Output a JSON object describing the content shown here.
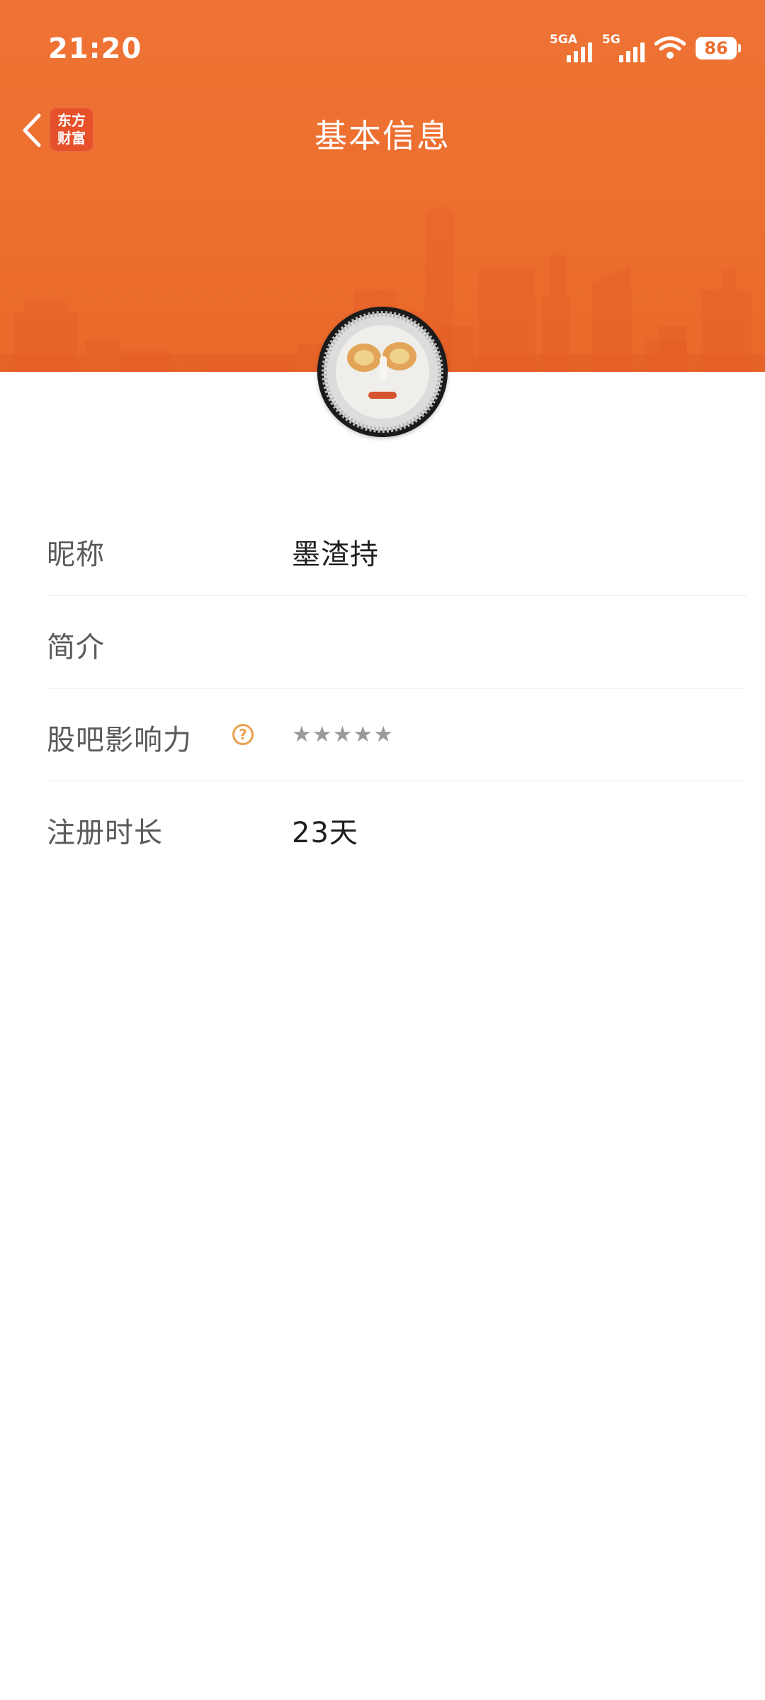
{
  "status_bar": {
    "time": "21:20",
    "network_1": "5GA",
    "network_2": "5G",
    "battery": "86",
    "icons": [
      "signal-5ga-icon",
      "signal-5g-icon",
      "wifi-icon",
      "battery-icon"
    ]
  },
  "nav": {
    "title": "基本信息",
    "back_icon": "chevron-left-icon",
    "logo_line1": "东方",
    "logo_line2": "财富"
  },
  "profile": {
    "avatar": "avatar-image"
  },
  "info": {
    "nickname": {
      "label": "昵称",
      "value": "墨渣持"
    },
    "bio": {
      "label": "简介",
      "value": ""
    },
    "influence": {
      "label": "股吧影响力",
      "help_icon": "question-circle-icon",
      "help_glyph": "?",
      "rating": 0,
      "max_rating": 5,
      "star_glyph": "★"
    },
    "registration": {
      "label": "注册时长",
      "value": "23天"
    }
  },
  "colors": {
    "header_orange": "#ec6f2f",
    "logo_red": "#e6512a",
    "help_icon": "#e9a04e",
    "star_empty": "#9a9a9a",
    "label_text": "#5a5a5a",
    "value_text": "#1f1f1f",
    "divider": "#ececec"
  }
}
